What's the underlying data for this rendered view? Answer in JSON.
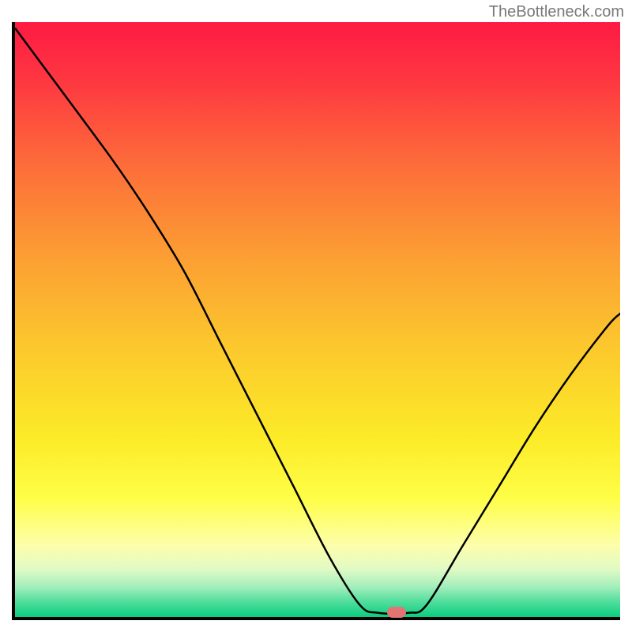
{
  "watermark": "TheBottleneck.com",
  "chart_data": {
    "type": "line",
    "title": "",
    "xlabel": "",
    "ylabel": "",
    "x_range": [
      0,
      100
    ],
    "y_range": [
      0,
      100
    ],
    "curve": [
      {
        "x": 0,
        "y": 99
      },
      {
        "x": 8,
        "y": 88
      },
      {
        "x": 16,
        "y": 77
      },
      {
        "x": 22,
        "y": 68
      },
      {
        "x": 28,
        "y": 58
      },
      {
        "x": 34,
        "y": 46
      },
      {
        "x": 40,
        "y": 34
      },
      {
        "x": 46,
        "y": 22
      },
      {
        "x": 52,
        "y": 10
      },
      {
        "x": 57,
        "y": 2
      },
      {
        "x": 60,
        "y": 0.7
      },
      {
        "x": 65,
        "y": 0.7
      },
      {
        "x": 68,
        "y": 2
      },
      {
        "x": 74,
        "y": 12
      },
      {
        "x": 80,
        "y": 22
      },
      {
        "x": 86,
        "y": 32
      },
      {
        "x": 92,
        "y": 41
      },
      {
        "x": 98,
        "y": 49
      },
      {
        "x": 100,
        "y": 51
      }
    ],
    "marker": {
      "x": 63,
      "y": 0.8,
      "color": "#e47373"
    },
    "gradient_stops": [
      {
        "offset": 0.0,
        "color": "#fe1a43"
      },
      {
        "offset": 0.1,
        "color": "#fe3841"
      },
      {
        "offset": 0.25,
        "color": "#fd7039"
      },
      {
        "offset": 0.4,
        "color": "#fca033"
      },
      {
        "offset": 0.55,
        "color": "#fcc92d"
      },
      {
        "offset": 0.7,
        "color": "#fceb28"
      },
      {
        "offset": 0.8,
        "color": "#fefe47"
      },
      {
        "offset": 0.88,
        "color": "#fdfeab"
      },
      {
        "offset": 0.92,
        "color": "#e0fac5"
      },
      {
        "offset": 0.95,
        "color": "#a1eebb"
      },
      {
        "offset": 0.975,
        "color": "#4fdd9c"
      },
      {
        "offset": 1.0,
        "color": "#0ace7f"
      }
    ]
  }
}
